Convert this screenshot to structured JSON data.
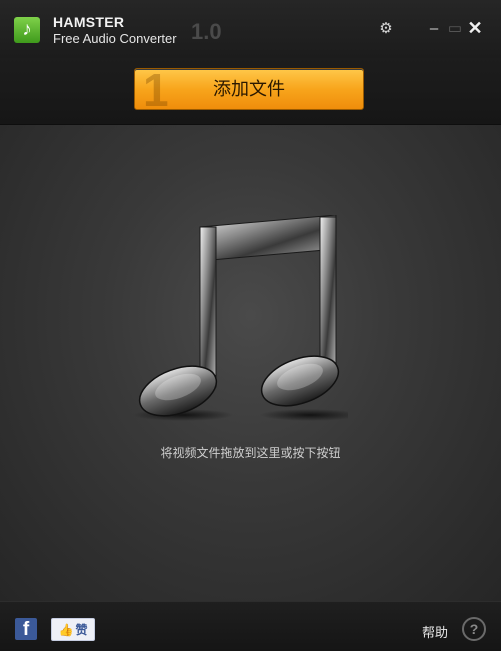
{
  "titlebar": {
    "logo_icon": "music-note-icon",
    "brand_name": "HAMSTER",
    "brand_sub": "Free Audio Converter",
    "version": "1.0",
    "settings_icon": "gear-icon",
    "minimize_glyph": "‒",
    "maximize_glyph": "▭",
    "close_glyph": "✕"
  },
  "toolbar": {
    "step_number": "1",
    "add_file_label": "添加文件"
  },
  "drop_area": {
    "icon": "music-note-icon",
    "hint": "将视频文件拖放到这里或按下按钮"
  },
  "footer": {
    "facebook_glyph": "f",
    "like_label": "赞",
    "help_label": "帮助",
    "help_glyph": "?"
  },
  "colors": {
    "accent_orange": "#f8a51c",
    "logo_green": "#5cb82e",
    "facebook_blue": "#3b5998"
  }
}
